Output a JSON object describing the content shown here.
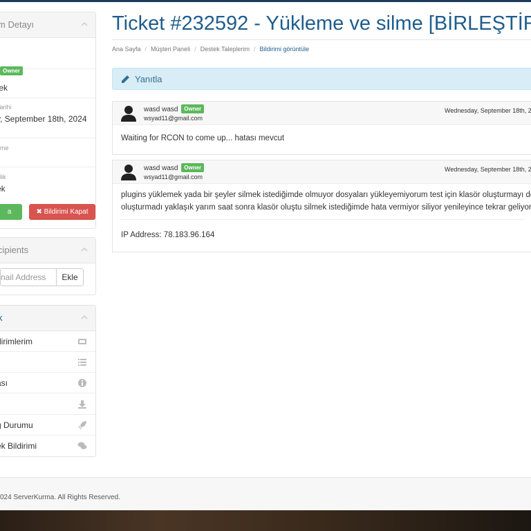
{
  "sidebar": {
    "ticket_panel": {
      "title": "m Detayı",
      "owner_badge": "Owner",
      "department_value": "tek",
      "date_label": "Tarihi",
      "date_value": "y, September 18th, 2024",
      "update_label": "eme",
      "update_value": "",
      "priority_label": "elik",
      "priority_value": "ek",
      "reply_button": "a",
      "close_button": "✖ Bildirimi Kapat"
    },
    "recipients_panel": {
      "title": "cipients",
      "email_placeholder": "nail Address",
      "add_button": "Ekle"
    },
    "menu_panel": {
      "title": "k",
      "items": [
        {
          "label": "dirimlerim",
          "icon": "ticket-icon"
        },
        {
          "label": "r",
          "icon": "list-icon"
        },
        {
          "label": "ası",
          "icon": "info-icon"
        },
        {
          "label": "",
          "icon": "download-icon"
        },
        {
          "label": "ğ Durumu",
          "icon": "rocket-icon"
        },
        {
          "label": "ek Bildirimi",
          "icon": "comments-icon"
        }
      ]
    }
  },
  "main": {
    "title": "Ticket #232592 - Yükleme ve silme [BİRLEŞTİRİ",
    "breadcrumb": [
      "Ana Sayfa",
      "Müşteri Paneli",
      "Destek Taleplerim",
      "Bildirimi görüntüle"
    ],
    "reply_label": "Yanıtla",
    "messages": [
      {
        "name": "wasd wasd",
        "badge": "Owner",
        "email": "wsyad11@gmail.com",
        "date": "Wednesday, September 18th, 2",
        "line1": "Waiting for RCON to come up... hatası mevcut"
      },
      {
        "name": "wasd wasd",
        "badge": "Owner",
        "email": "wsyad11@gmail.com",
        "date": "Wednesday, September 18th, 2",
        "line1": "plugins yüklemek yada bir şeyler silmek istediğimde olmuyor dosyaları yükleyemiyorum test için klasör oluşturmayı de",
        "line2": "oluşturmadı yaklaşık yarım saat sonra klasör oluştu silmek istediğimde hata vermiyor siliyor yenileyince tekrar geliyor",
        "ip": "IP Address: 78.183.96.164"
      }
    ]
  },
  "footer": {
    "text": "024 ServerKurma. All Rights Reserved."
  },
  "colors": {
    "accent": "#1e5d8c",
    "owner_green": "#5cb85c",
    "danger_red": "#d9534f",
    "info_bg": "#d9edf7"
  }
}
